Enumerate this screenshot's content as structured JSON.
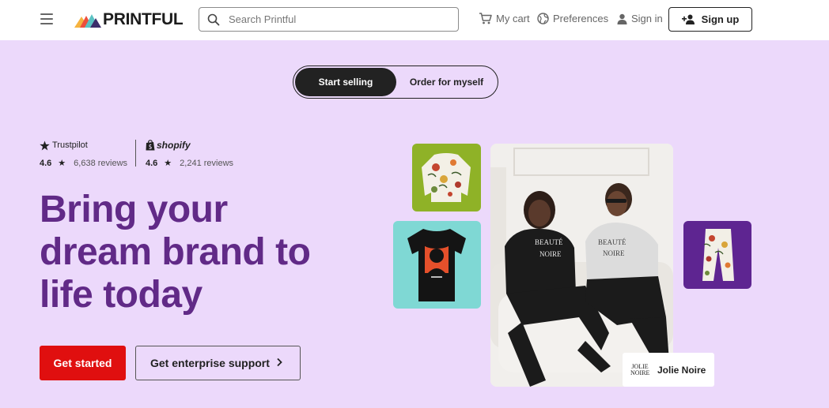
{
  "header": {
    "logo_text": "PRINTFUL",
    "search_placeholder": "Search Printful",
    "cart_label": "My cart",
    "preferences_label": "Preferences",
    "signin_label": "Sign in",
    "signup_label": "Sign up"
  },
  "hero": {
    "toggle": {
      "active": "Start selling",
      "inactive": "Order for myself"
    },
    "ratings": {
      "trustpilot": {
        "brand": "Trustpilot",
        "score": "4.6",
        "reviews": "6,638 reviews"
      },
      "shopify": {
        "brand": "shopify",
        "score": "4.6",
        "reviews": "2,241 reviews"
      }
    },
    "headline": [
      "Bring your",
      "dream brand to",
      "life today"
    ],
    "primary_cta": "Get started",
    "secondary_cta": "Get enterprise support",
    "brand_label": {
      "logo": "JOLIE NOIRE",
      "name": "Jolie Noire"
    },
    "shirt_texts": [
      "BEAUTÉ",
      "NOIRE"
    ]
  },
  "colors": {
    "hero_bg": "#ecd9fb",
    "headline": "#612a87",
    "primary_button": "#e00f0f",
    "sweater_bg": "#8fb227",
    "tshirt_bg": "#7fd8d4",
    "pants_bg": "#5e2591"
  }
}
